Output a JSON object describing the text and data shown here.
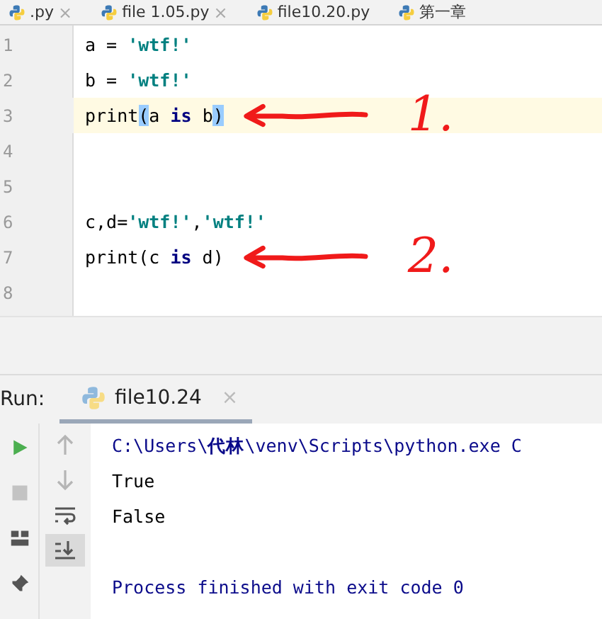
{
  "editor_tabs": [
    {
      "label": ".py",
      "close": "×"
    },
    {
      "label": "file 1.05.py",
      "close": "×"
    },
    {
      "label": "file10.20.py"
    },
    {
      "label": "第一章"
    }
  ],
  "editor": {
    "lines": [
      {
        "number": "1",
        "current": false,
        "tokens": [
          {
            "text": "a = ",
            "kind": "plain"
          },
          {
            "text": "'wtf!'",
            "kind": "string"
          }
        ]
      },
      {
        "number": "2",
        "current": false,
        "tokens": [
          {
            "text": "b = ",
            "kind": "plain"
          },
          {
            "text": "'wtf!'",
            "kind": "string"
          }
        ]
      },
      {
        "number": "3",
        "current": true,
        "tokens": [
          {
            "text": "print",
            "kind": "plain"
          },
          {
            "text": "(",
            "kind": "match"
          },
          {
            "text": "a ",
            "kind": "plain"
          },
          {
            "text": "is",
            "kind": "keyword"
          },
          {
            "text": " b",
            "kind": "plain"
          },
          {
            "text": ")",
            "kind": "match"
          }
        ],
        "annotation": "1."
      },
      {
        "number": "4",
        "current": false
      },
      {
        "number": "5",
        "current": false
      },
      {
        "number": "6",
        "current": false,
        "tokens": [
          {
            "text": "c,d=",
            "kind": "plain"
          },
          {
            "text": "'wtf!'",
            "kind": "string"
          },
          {
            "text": ",",
            "kind": "plain"
          },
          {
            "text": "'wtf!'",
            "kind": "string"
          }
        ]
      },
      {
        "number": "7",
        "current": false,
        "tokens": [
          {
            "text": "print(c ",
            "kind": "plain"
          },
          {
            "text": "is",
            "kind": "keyword"
          },
          {
            "text": " d)",
            "kind": "plain"
          }
        ],
        "annotation": "2."
      },
      {
        "number": "8",
        "current": false
      }
    ]
  },
  "run_panel": {
    "label": "Run:",
    "tab": {
      "label": "file10.24",
      "close": "×",
      "selected": true
    },
    "toolbar_left": [
      {
        "kind": "run"
      },
      {
        "kind": "stop"
      },
      {
        "kind": "layout"
      },
      {
        "kind": "pin"
      }
    ],
    "toolbar_right": [
      {
        "kind": "up",
        "selected": false
      },
      {
        "kind": "down",
        "selected": false
      },
      {
        "kind": "wrap",
        "selected": false
      },
      {
        "kind": "scroll-end",
        "selected": true
      }
    ],
    "console": [
      {
        "kind": "command",
        "text": "C:\\Users\\**代林**\\venv\\Scripts\\python.exe C"
      },
      {
        "kind": "output",
        "text": "True"
      },
      {
        "kind": "output",
        "text": "False"
      },
      {
        "kind": "blank"
      },
      {
        "kind": "exit",
        "text": "Process finished with exit code 0"
      }
    ]
  }
}
